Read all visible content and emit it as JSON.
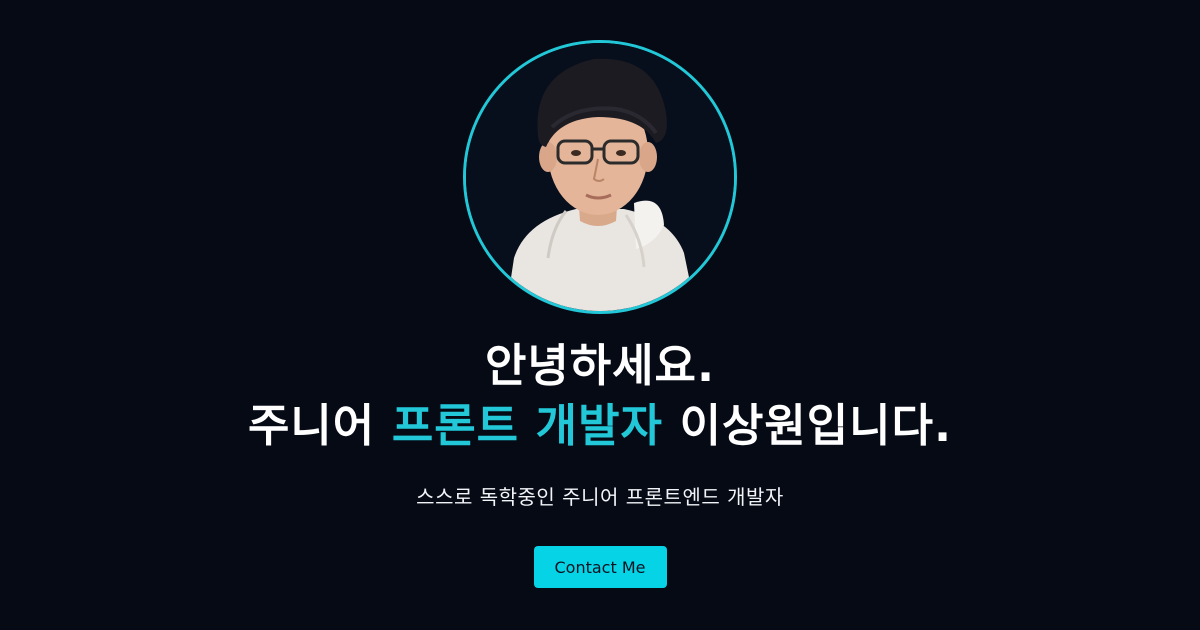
{
  "profile": {
    "avatar_alt": "이상원",
    "ring_color": "#22c8d8"
  },
  "headline": {
    "line1": "안녕하세요.",
    "line2_prefix": "주니어",
    "line2_accent": "프론트 개발자",
    "line2_suffix": "이상원입니다."
  },
  "subtitle": "스스로 독학중인 주니어 프론트엔드 개발자",
  "cta": {
    "label": "Contact Me",
    "color": "#06d4e6"
  },
  "theme": {
    "background": "#050a15",
    "accent": "#22c8d8"
  }
}
